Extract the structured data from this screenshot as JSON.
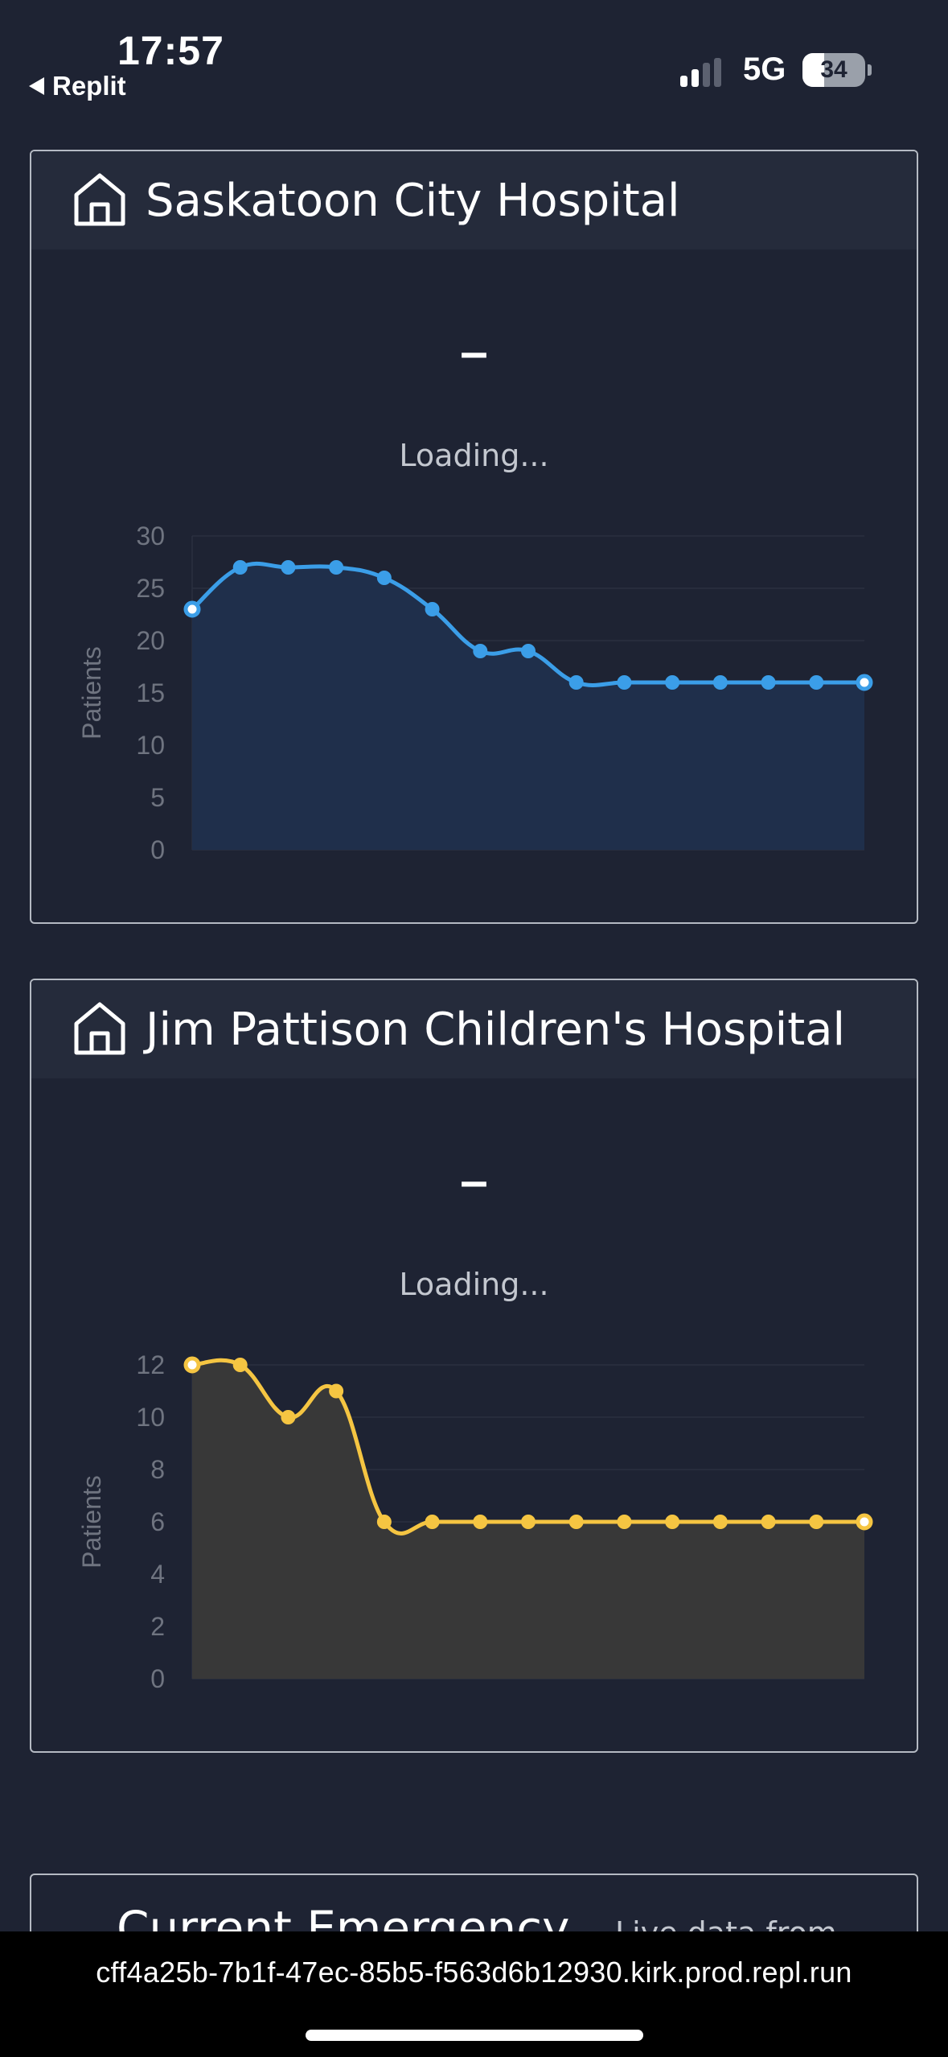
{
  "status_bar": {
    "time": "17:57",
    "back_app": "Replit",
    "network": "5G",
    "battery": "34",
    "battery_level": 0.34
  },
  "hospitals": [
    {
      "name": "Saskatoon City Hospital",
      "value": "–",
      "status": "Loading..."
    },
    {
      "name": "Jim Pattison Children's Hospital",
      "value": "–",
      "status": "Loading..."
    }
  ],
  "chart_data": [
    {
      "type": "area",
      "ylabel": "Patients",
      "ylim": [
        0,
        30
      ],
      "yticks": [
        0,
        5,
        10,
        15,
        20,
        25,
        30
      ],
      "grid": true,
      "color": "#3b9ee8",
      "fill": "#1f2f4b",
      "values": [
        23,
        27,
        27,
        27,
        26,
        23,
        19,
        19,
        16,
        16,
        16,
        16,
        16,
        16,
        16
      ]
    },
    {
      "type": "area",
      "ylabel": "Patients",
      "ylim": [
        0,
        12
      ],
      "yticks": [
        0,
        2,
        4,
        6,
        8,
        10,
        12
      ],
      "grid": true,
      "color": "#f5c542",
      "fill": "#383838",
      "values": [
        12,
        12,
        10,
        11,
        6,
        6,
        6,
        6,
        6,
        6,
        6,
        6,
        6,
        6,
        6
      ]
    }
  ],
  "partial_card": {
    "title": "Current Emergency",
    "subtitle": "Live data from"
  },
  "url_bar": {
    "url": "cff4a25b-7b1f-47ec-85b5-f563d6b12930.kirk.prod.repl.run"
  }
}
